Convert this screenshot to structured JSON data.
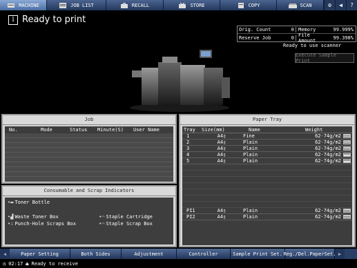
{
  "top_tabs": [
    {
      "label": "MACHINE",
      "icon": "copier-icon",
      "active": true
    },
    {
      "label": "JOB LIST",
      "icon": "list-icon",
      "active": false
    },
    {
      "label": "RECALL",
      "icon": "recall-icon",
      "active": false
    },
    {
      "label": "STORE",
      "icon": "store-icon",
      "active": false
    },
    {
      "label": "COPY",
      "icon": "copy-icon",
      "active": false
    },
    {
      "label": "SCAN",
      "icon": "scan-icon",
      "active": false
    }
  ],
  "status": {
    "title": "Ready to print",
    "scanner_message": "Ready to use scanner",
    "sample_button": "Execute Sample Print"
  },
  "counters": {
    "orig_count_label": "Orig. Count",
    "orig_count": "0",
    "memory_label": "Memory",
    "memory": "99.999%",
    "reserve_job_label": "Reserve Job",
    "reserve_job": "0",
    "file_amount_label": "File Amount",
    "file_amount": "99.398%"
  },
  "job_panel": {
    "title": "Job",
    "columns": [
      "No.",
      "Mode",
      "Status",
      "Minute(S)",
      "User Name"
    ]
  },
  "consumables": {
    "title": "Consumable and Scrap Indicators",
    "items": [
      "Toner Bottle",
      "Waste Toner Box",
      "Staple Cartridge",
      "Punch-Hole Scraps Box",
      "Staple Scrap Box"
    ]
  },
  "paper_tray": {
    "title": "Paper Tray",
    "columns": [
      "Tray",
      "Size(mm)",
      "Name",
      "Weight"
    ],
    "rows": [
      {
        "tray": "1",
        "size": "A4",
        "name": "Fine",
        "weight": "62-74g/m2",
        "level": "full"
      },
      {
        "tray": "2",
        "size": "A4",
        "name": "Plain",
        "weight": "62-74g/m2",
        "level": "full"
      },
      {
        "tray": "3",
        "size": "A4",
        "name": "Plain",
        "weight": "62-74g/m2",
        "level": "full"
      },
      {
        "tray": "4",
        "size": "A4",
        "name": "Plain",
        "weight": "62-74g/m2",
        "level": "half"
      },
      {
        "tray": "5",
        "size": "A4",
        "name": "Plain",
        "weight": "62-74g/m2",
        "level": "half"
      }
    ],
    "pi_rows": [
      {
        "tray": "PI1",
        "size": "A4",
        "name": "Plain",
        "weight": "62-74g/m2",
        "level": "full"
      },
      {
        "tray": "PI2",
        "size": "A4",
        "name": "Plain",
        "weight": "62-74g/m2",
        "level": "full"
      }
    ]
  },
  "bottom_buttons": [
    "Paper Setting",
    "Both Sides",
    "Adjustment",
    "Controller",
    "Sample Print Set.",
    "Reg./Del.PaperSet."
  ],
  "statusbar": {
    "time": "02:17",
    "message": "Ready to receive"
  },
  "colors": {
    "accent": "#2a3f66",
    "active_tab": "#6f8fc0"
  }
}
